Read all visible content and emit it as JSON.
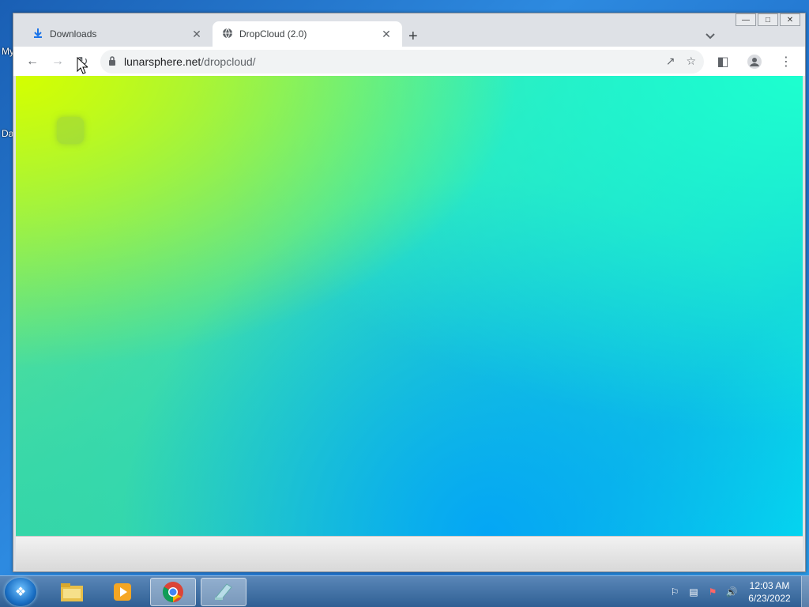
{
  "desktop": {
    "labels": [
      "My",
      "Da"
    ]
  },
  "browser": {
    "tabs": [
      {
        "title": "Downloads",
        "icon": "download-icon",
        "active": false
      },
      {
        "title": "DropCloud (2.0)",
        "icon": "globe-icon",
        "active": true
      }
    ],
    "address": {
      "host": "lunarsphere.net",
      "path": "/dropcloud/"
    }
  },
  "taskbar": {
    "apps": [
      "start-orb",
      "file-explorer",
      "media-player",
      "chrome",
      "notepad"
    ],
    "clock": {
      "time": "12:03 AM",
      "date": "6/23/2022"
    }
  },
  "colors": {
    "gradient_top_left": "#d4ff00",
    "gradient_top_right": "#1dffcf",
    "gradient_bottom": "#04a6f5"
  }
}
